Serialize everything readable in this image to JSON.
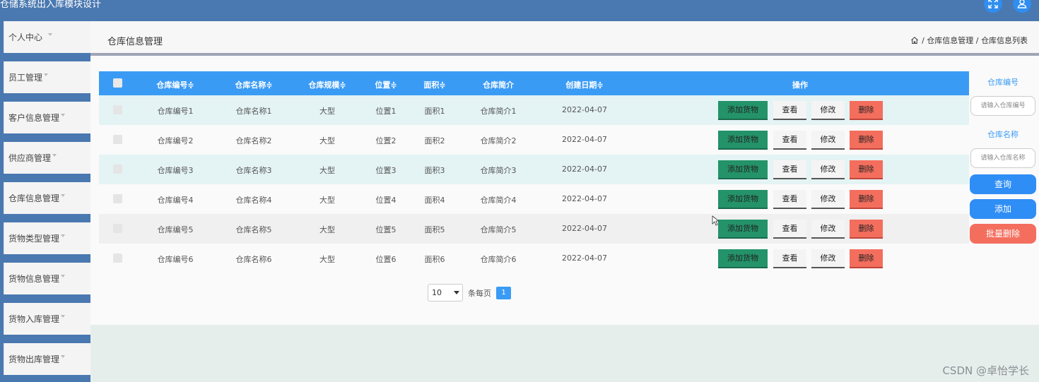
{
  "app": {
    "title": "仓储系统出入库模块设计"
  },
  "sidebar": {
    "items": [
      {
        "label": "个人中心"
      },
      {
        "label": "员工管理"
      },
      {
        "label": "客户信息管理"
      },
      {
        "label": "供应商管理"
      },
      {
        "label": "仓库信息管理"
      },
      {
        "label": "货物类型管理"
      },
      {
        "label": "货物信息管理"
      },
      {
        "label": "货物入库管理"
      },
      {
        "label": "货物出库管理"
      }
    ]
  },
  "header": {
    "title": "仓库信息管理",
    "breadcrumb": "/ 仓库信息管理 / 仓库信息列表"
  },
  "table": {
    "columns": [
      {
        "label": "仓库编号≑"
      },
      {
        "label": "仓库名称≑"
      },
      {
        "label": "仓库规模≑"
      },
      {
        "label": "位置≑"
      },
      {
        "label": "面积≑"
      },
      {
        "label": "仓库简介"
      },
      {
        "label": "创建日期≑"
      },
      {
        "label": "操作"
      }
    ],
    "rows": [
      {
        "code": "仓库编号1",
        "name": "仓库名称1",
        "scale": "大型",
        "position": "位置1",
        "area": "面积1",
        "intro": "仓库简介1",
        "date": "2022-04-07"
      },
      {
        "code": "仓库编号2",
        "name": "仓库名称2",
        "scale": "大型",
        "position": "位置2",
        "area": "面积2",
        "intro": "仓库简介2",
        "date": "2022-04-07"
      },
      {
        "code": "仓库编号3",
        "name": "仓库名称3",
        "scale": "大型",
        "position": "位置3",
        "area": "面积3",
        "intro": "仓库简介3",
        "date": "2022-04-07"
      },
      {
        "code": "仓库编号4",
        "name": "仓库名称4",
        "scale": "大型",
        "position": "位置4",
        "area": "面积4",
        "intro": "仓库简介4",
        "date": "2022-04-07"
      },
      {
        "code": "仓库编号5",
        "name": "仓库名称5",
        "scale": "大型",
        "position": "位置5",
        "area": "面积5",
        "intro": "仓库简介5",
        "date": "2022-04-07"
      },
      {
        "code": "仓库编号6",
        "name": "仓库名称6",
        "scale": "大型",
        "position": "位置6",
        "area": "面积6",
        "intro": "仓库简介6",
        "date": "2022-04-07"
      }
    ],
    "actions": {
      "add_goods": "添加货物",
      "view": "查看",
      "edit": "修改",
      "delete": "删除"
    }
  },
  "pager": {
    "page_size": "10",
    "per_page_label": "条每页",
    "current_page": "1"
  },
  "search": {
    "code_label": "仓库编号",
    "code_placeholder": "请输入仓库编号",
    "name_label": "仓库名称",
    "name_placeholder": "请输入仓库名称",
    "query_button": "查询",
    "add_button": "添加",
    "batch_delete_button": "批量删除"
  },
  "watermark": "CSDN @卓怡学长",
  "colors": {
    "topbar": "#4a78b0",
    "table_header": "#3a9bf5",
    "add_goods": "#24936a",
    "delete": "#f46e5e",
    "row_stripe": "#e4f3f4"
  }
}
